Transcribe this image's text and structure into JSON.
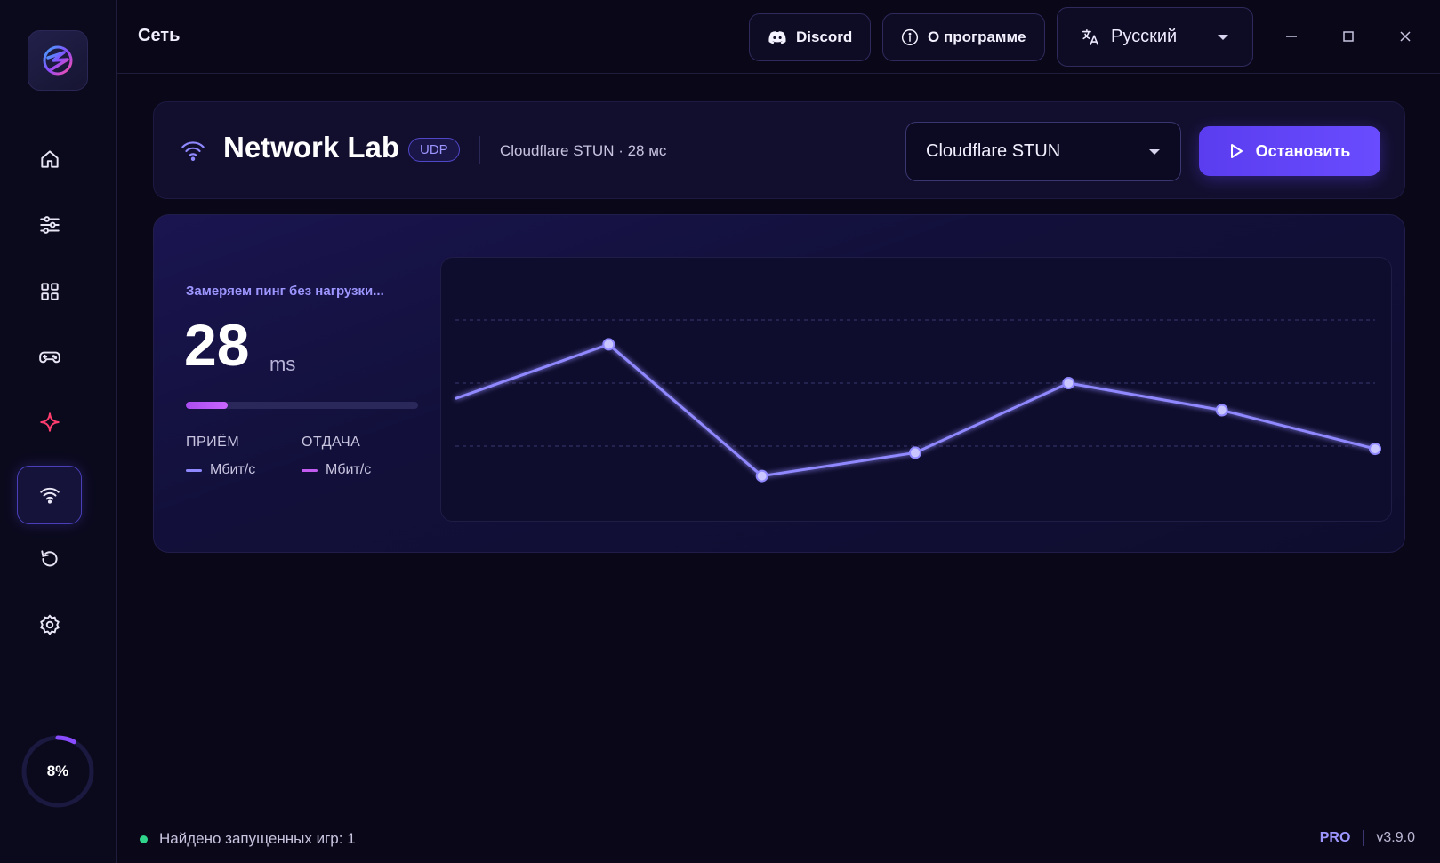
{
  "page": {
    "title": "Сеть"
  },
  "topbar": {
    "discord_label": "Discord",
    "about_label": "О программе",
    "language": "Русский"
  },
  "sidebar": {
    "items": [
      {
        "name": "home",
        "icon": "home-icon"
      },
      {
        "name": "tweaks",
        "icon": "sliders-icon"
      },
      {
        "name": "apps",
        "icon": "grid-icon"
      },
      {
        "name": "games",
        "icon": "gamepad-icon"
      },
      {
        "name": "boost",
        "icon": "sparkle-icon"
      },
      {
        "name": "network",
        "icon": "wifi-icon",
        "active": true
      },
      {
        "name": "restore",
        "icon": "undo-icon"
      },
      {
        "name": "settings",
        "icon": "gear-icon"
      }
    ],
    "progress_label": "8%",
    "progress_value": 0.08
  },
  "header": {
    "title": "Network Lab",
    "protocol": "UDP",
    "subinfo": "Cloudflare STUN · 28 мс",
    "server": "Cloudflare STUN",
    "stop_label": "Остановить"
  },
  "panel": {
    "status": "Замеряем пинг без нагрузки...",
    "ping": "28",
    "ping_unit": "ms",
    "ping_bar_fraction": 0.18,
    "rx_label": "ПРИЁМ",
    "rx_value": "Мбит/с",
    "tx_label": "ОТДАЧА",
    "tx_value": "Мбит/с"
  },
  "colors": {
    "accent": "#6a4cff",
    "line": "#8f88ff",
    "rx": "#8f88ff",
    "tx": "#c25cf0",
    "status_ok": "#2fd48a"
  },
  "chart_data": {
    "type": "line",
    "x": [
      0,
      1,
      2,
      3,
      4,
      5,
      6
    ],
    "series": [
      {
        "values": [
          34,
          48,
          14,
          20,
          38,
          31,
          21
        ]
      }
    ],
    "ylim": [
      10,
      52
    ],
    "grid": true,
    "xlabel": "",
    "ylabel": "",
    "title": ""
  },
  "statusbar": {
    "games_found": "Найдено запущенных игр: 1",
    "tier": "PRO",
    "version": "v3.9.0"
  }
}
